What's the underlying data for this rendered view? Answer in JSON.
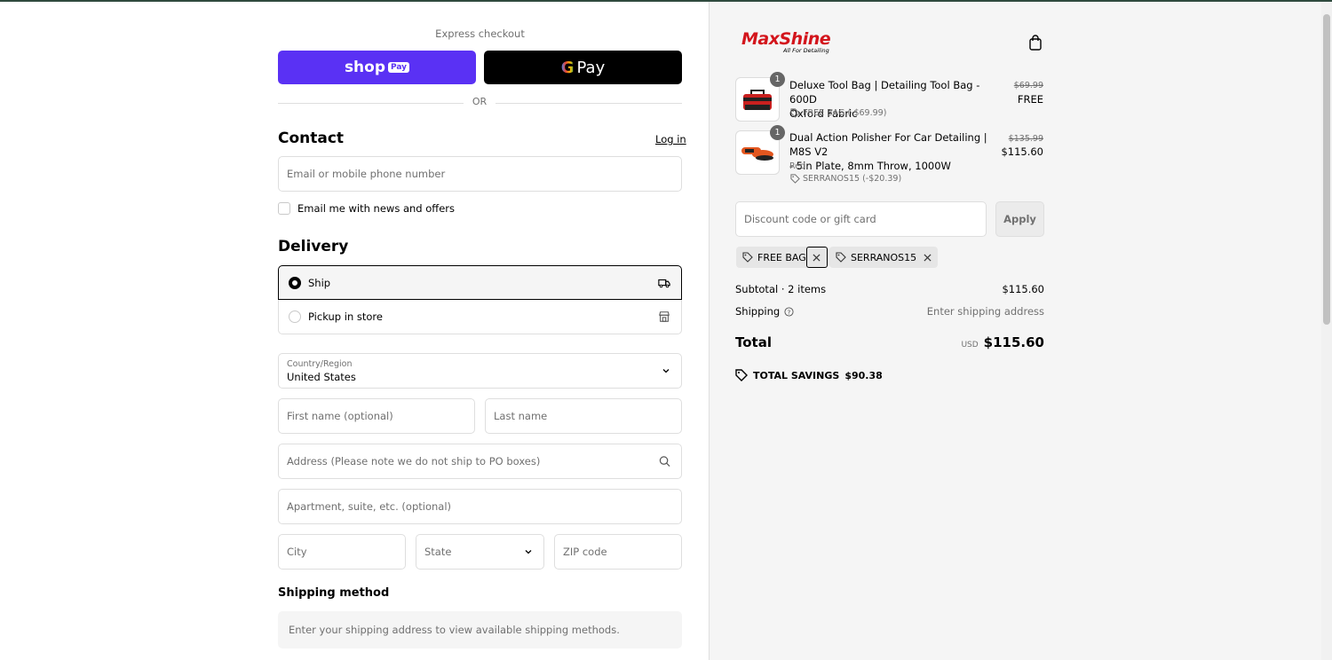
{
  "express": {
    "label": "Express checkout",
    "shop_pay": {
      "text": "shop",
      "badge": "Pay"
    },
    "gpay": {
      "g": "G",
      "text": "Pay"
    },
    "or": "OR"
  },
  "contact": {
    "title": "Contact",
    "login": "Log in",
    "email_placeholder": "Email or mobile phone number",
    "news_label": "Email me with news and offers"
  },
  "delivery": {
    "title": "Delivery",
    "options": [
      {
        "label": "Ship",
        "selected": true,
        "icon": "truck-icon"
      },
      {
        "label": "Pickup in store",
        "selected": false,
        "icon": "store-icon"
      }
    ],
    "country_label": "Country/Region",
    "country_value": "United States",
    "first_name": "First name (optional)",
    "last_name": "Last name",
    "address": "Address (Please note we do not ship to PO boxes)",
    "apartment": "Apartment, suite, etc. (optional)",
    "city": "City",
    "state": "State",
    "zip": "ZIP code"
  },
  "shipping_method": {
    "title": "Shipping method",
    "message": "Enter your shipping address to view available shipping methods."
  },
  "store": {
    "brand": "MaxShine",
    "tagline": "All For Detailing"
  },
  "cart": {
    "items": [
      {
        "qty": "1",
        "title_line1": "Deluxe Tool Bag | Detailing Tool Bag - 600D",
        "title_line2": "Oxford Fabric",
        "discount": "FREE BAG (-$69.99)",
        "original": "$69.99",
        "price": "FREE"
      },
      {
        "qty": "1",
        "title_line1": "Dual Action Polisher For Car Detailing | M8S V2",
        "title_line2": "- 5in Plate, 8mm Throw, 1000W",
        "variant": "Red",
        "discount": "SERRANOS15 (-$20.39)",
        "original": "$135.99",
        "price": "$115.60"
      }
    ]
  },
  "discount": {
    "placeholder": "Discount code or gift card",
    "apply": "Apply",
    "chips": [
      "FREE BAG",
      "SERRANOS15"
    ]
  },
  "summary": {
    "subtotal_label": "Subtotal · 2 items",
    "subtotal_value": "$115.60",
    "shipping_label": "Shipping",
    "shipping_value": "Enter shipping address",
    "total_label": "Total",
    "currency": "USD",
    "total_value": "$115.60",
    "savings_label": "TOTAL SAVINGS",
    "savings_value": "$90.38"
  }
}
